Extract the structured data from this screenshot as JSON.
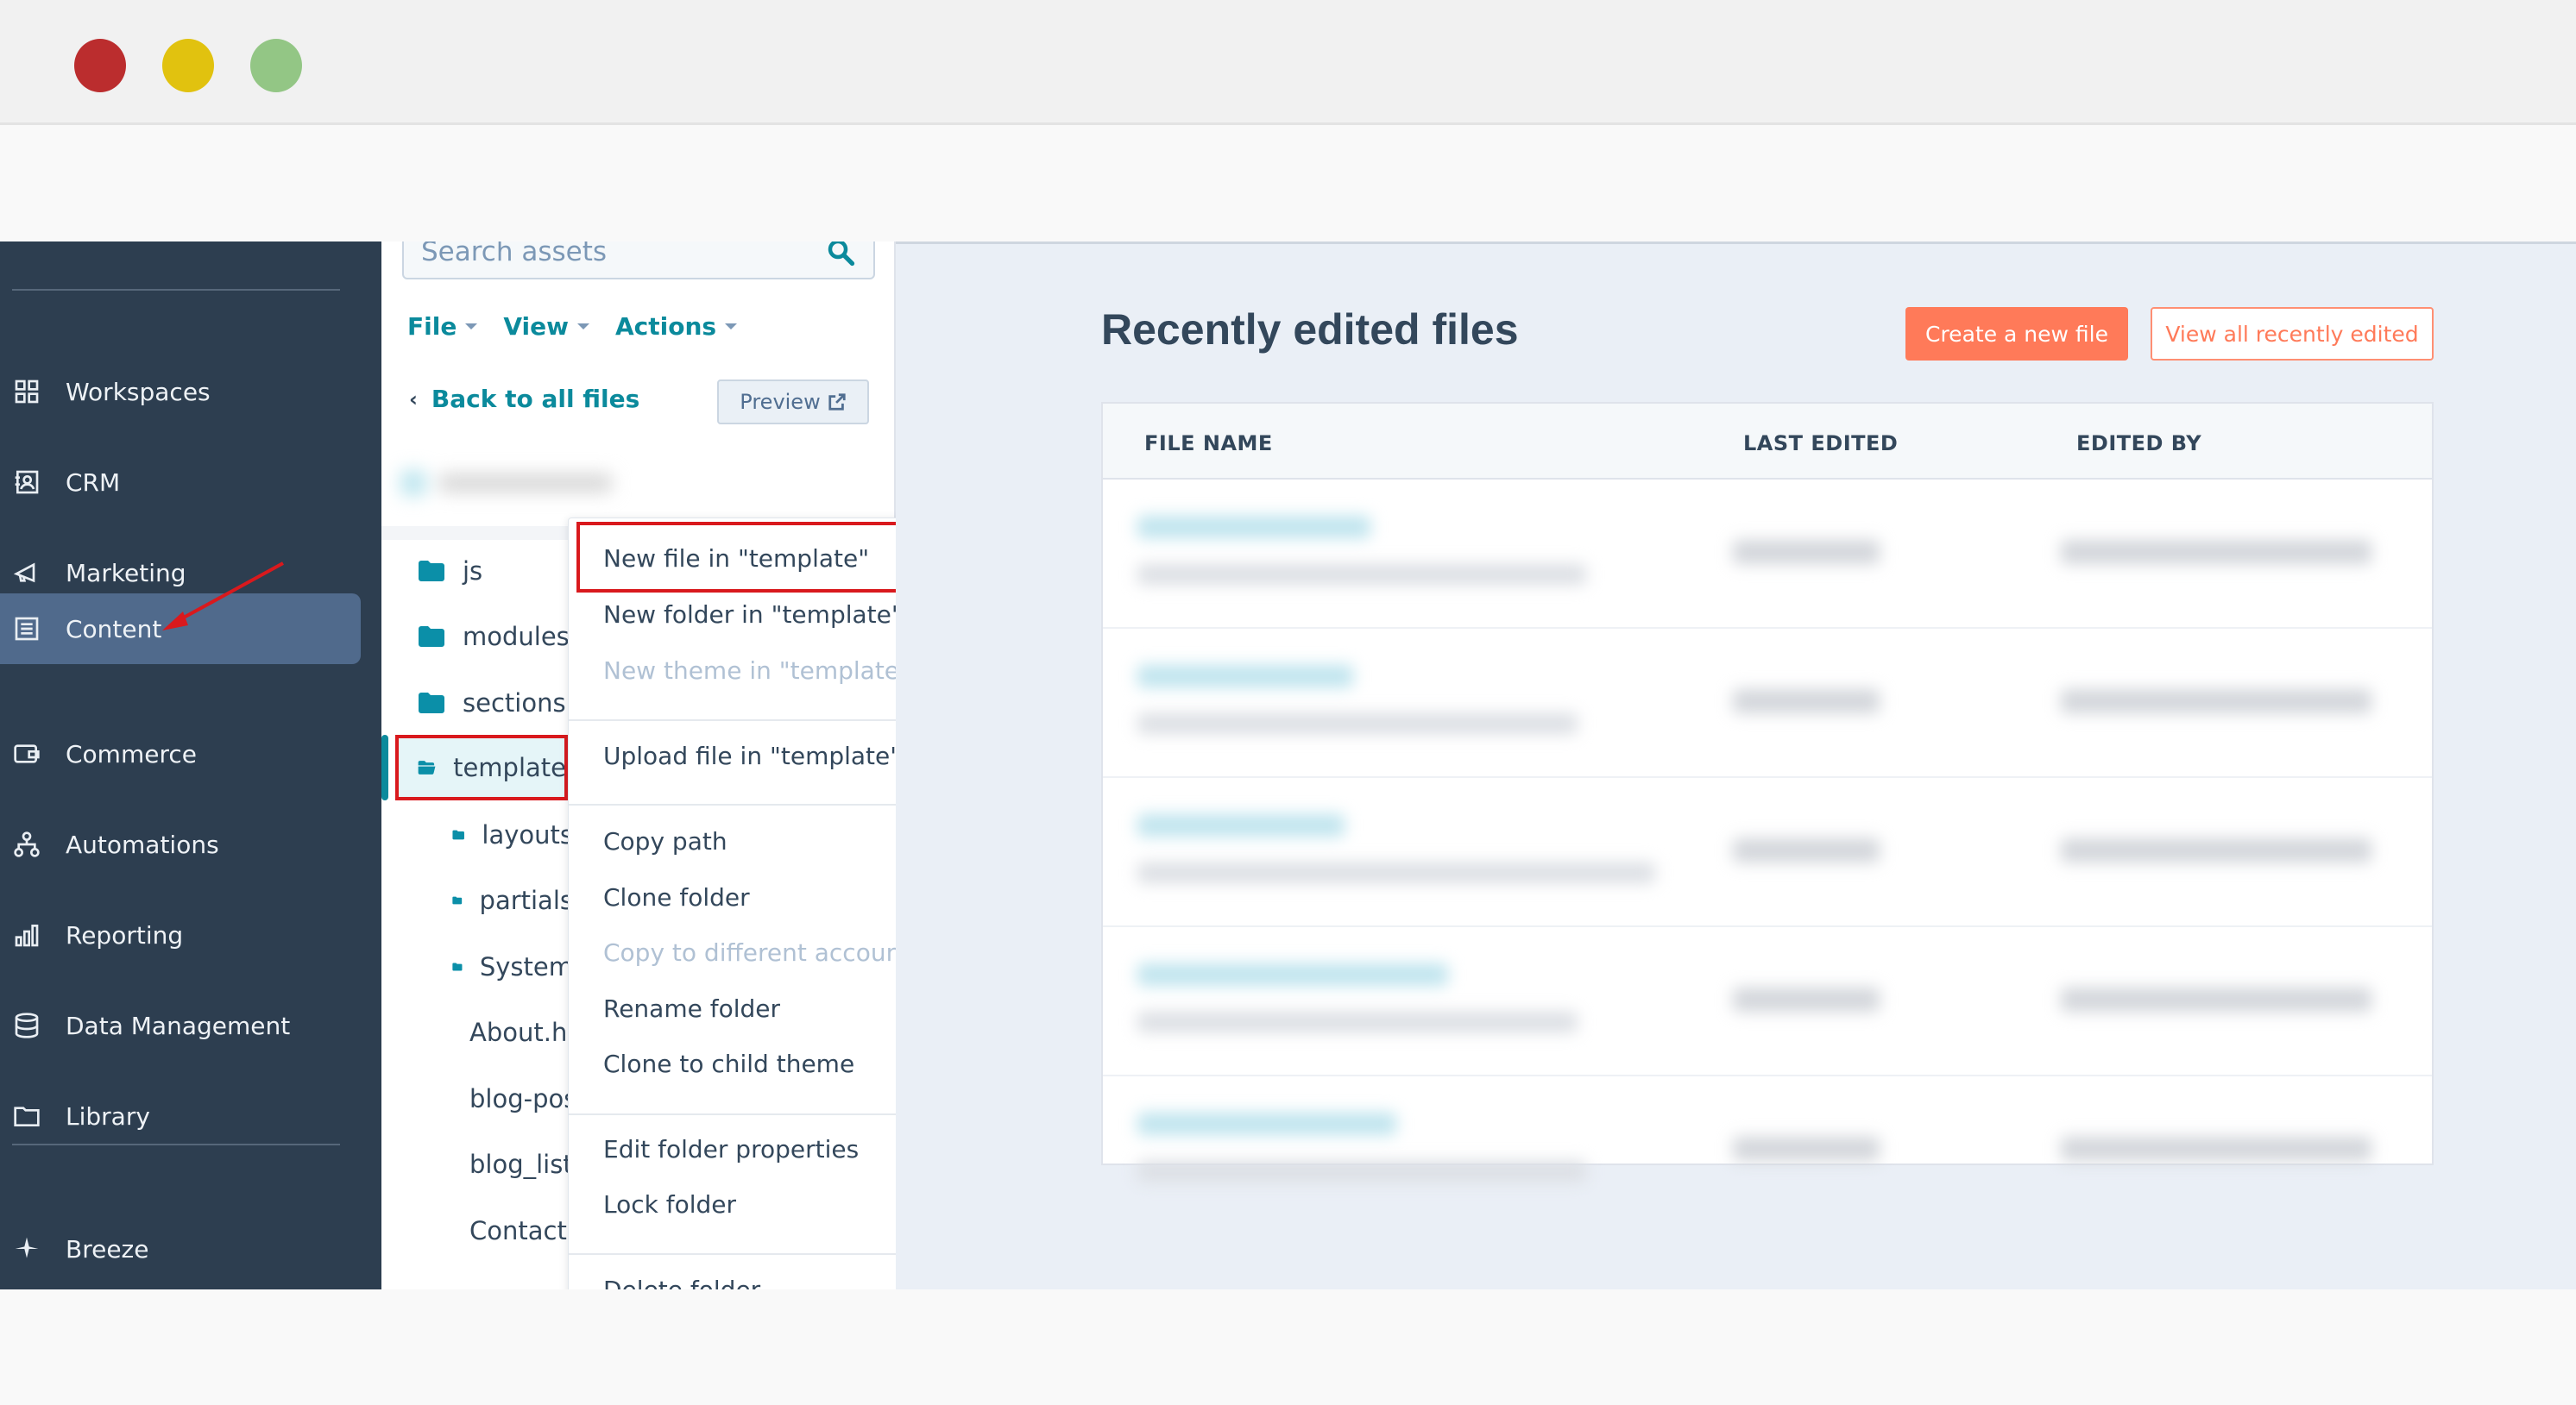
{
  "window": {
    "controls": [
      "close",
      "minimize",
      "maximize"
    ],
    "colors": {
      "close": "#bb2d2e",
      "minimize": "#e1c20f",
      "maximize": "#93c685"
    }
  },
  "sidebar": {
    "items": [
      {
        "label": "Workspaces",
        "icon": "grid-icon"
      },
      {
        "label": "CRM",
        "icon": "contact-card-icon"
      },
      {
        "label": "Marketing",
        "icon": "megaphone-icon"
      },
      {
        "label": "Content",
        "icon": "content-icon",
        "active": true
      },
      {
        "label": "Commerce",
        "icon": "wallet-icon"
      },
      {
        "label": "Automations",
        "icon": "workflow-icon"
      },
      {
        "label": "Reporting",
        "icon": "bar-chart-icon"
      },
      {
        "label": "Data Management",
        "icon": "database-icon"
      },
      {
        "label": "Library",
        "icon": "folder-icon"
      }
    ],
    "footer_item": {
      "label": "Breeze",
      "icon": "sparkle-icon"
    }
  },
  "files_panel": {
    "search": {
      "placeholder": "Search assets"
    },
    "menus": [
      "File",
      "View",
      "Actions"
    ],
    "back_link": "Back to all files",
    "preview_button": "Preview",
    "tree": [
      {
        "name": "js",
        "type": "folder",
        "level": 0
      },
      {
        "name": "modules",
        "type": "folder",
        "level": 0
      },
      {
        "name": "sections",
        "type": "folder",
        "level": 0
      },
      {
        "name": "template",
        "type": "folder-open",
        "level": 0,
        "selected": true
      },
      {
        "name": "layouts",
        "type": "folder",
        "level": 1
      },
      {
        "name": "partials",
        "type": "folder",
        "level": 1
      },
      {
        "name": "System",
        "type": "folder",
        "level": 1
      },
      {
        "name": "About.html",
        "type": "code-file",
        "level": 1
      },
      {
        "name": "blog-post.html",
        "type": "code-file",
        "level": 1
      },
      {
        "name": "blog_listing.html",
        "type": "code-file",
        "level": 1
      },
      {
        "name": "Contact.html",
        "type": "code-file",
        "level": 1
      }
    ]
  },
  "context_menu": {
    "groups": [
      [
        {
          "label": "New file in \"template\"",
          "disabled": false,
          "highlighted": true
        },
        {
          "label": "New folder in \"template\"",
          "disabled": false
        },
        {
          "label": "New theme in \"template\"",
          "disabled": true
        }
      ],
      [
        {
          "label": "Upload file in \"template\"",
          "disabled": false
        }
      ],
      [
        {
          "label": "Copy path",
          "disabled": false
        },
        {
          "label": "Clone folder",
          "disabled": false
        },
        {
          "label": "Copy to different account",
          "disabled": true
        },
        {
          "label": "Rename folder",
          "disabled": false
        },
        {
          "label": "Clone to child theme",
          "disabled": false
        }
      ],
      [
        {
          "label": "Edit folder properties",
          "disabled": false
        },
        {
          "label": "Lock folder",
          "disabled": false
        }
      ],
      [
        {
          "label": "Delete folder",
          "disabled": false
        }
      ]
    ]
  },
  "main": {
    "title": "Recently edited files",
    "create_button": "Create a new file",
    "view_all_button": "View all recently edited",
    "table": {
      "columns": [
        "FILE NAME",
        "LAST EDITED",
        "EDITED BY"
      ],
      "row_count": 5,
      "rows_redacted": true
    }
  },
  "colors": {
    "sidebar_bg": "#2d3e50",
    "sidebar_active": "#506a8c",
    "accent_teal": "#0b8a9c",
    "primary_orange": "#ff7a59",
    "annotation_red": "#d9191d"
  }
}
